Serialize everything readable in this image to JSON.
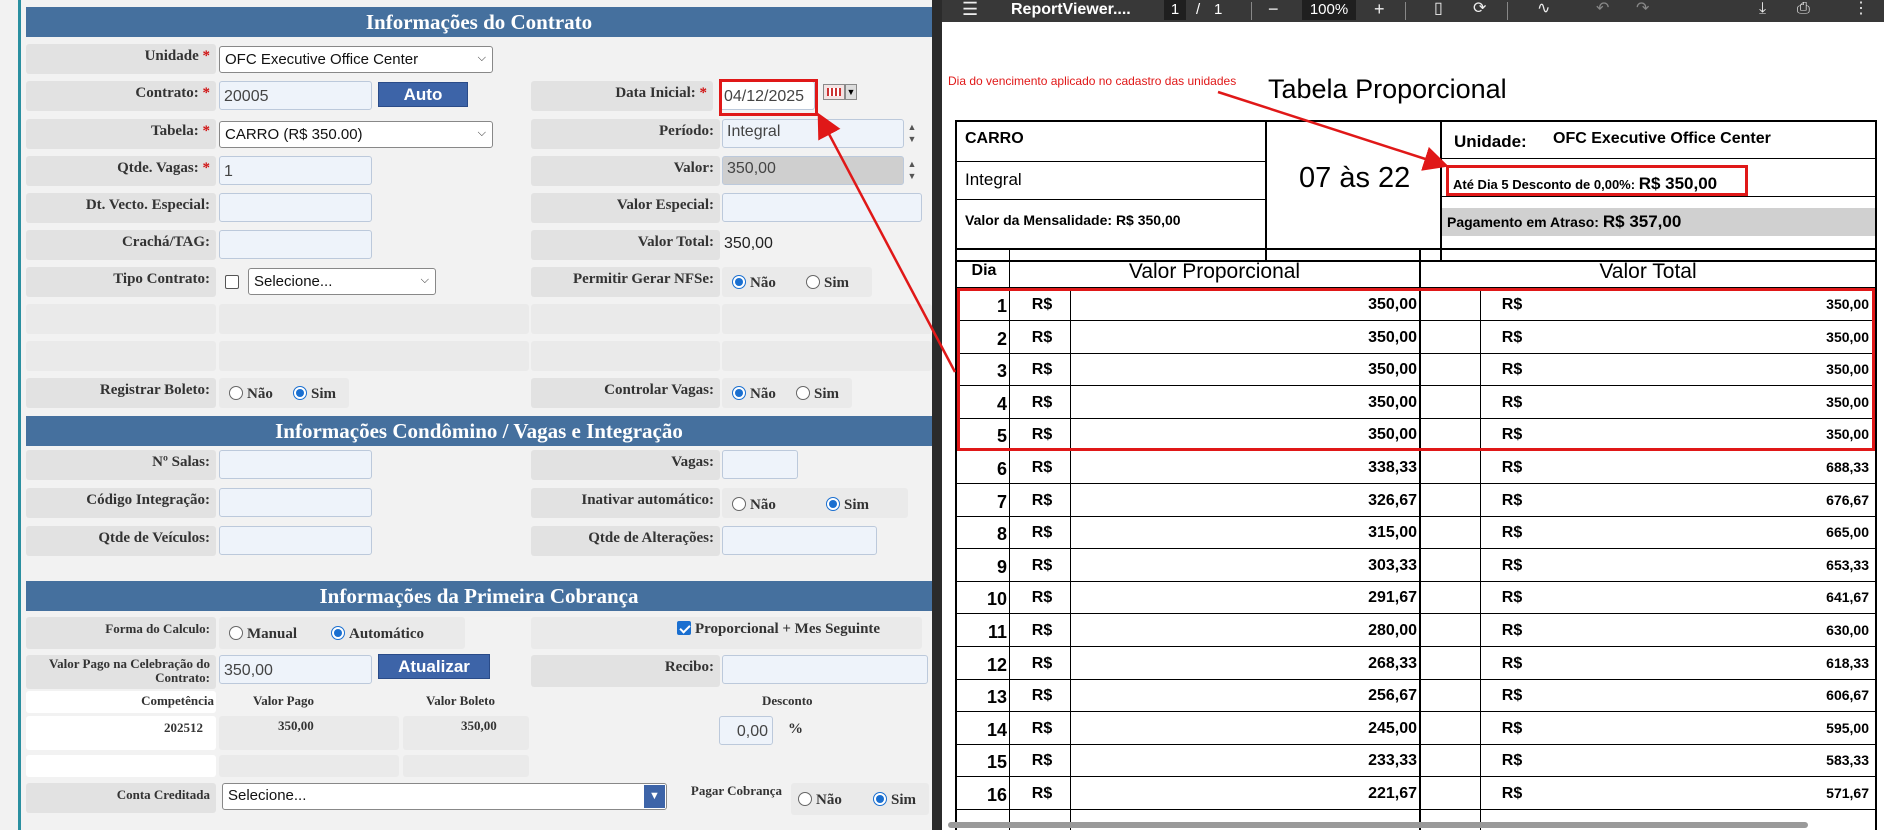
{
  "sections": {
    "contract": "Informações do Contrato",
    "condo": "Informações Condômino / Vagas e Integração",
    "billing": "Informações da Primeira Cobrança"
  },
  "contract": {
    "unidade_label": "Unidade",
    "unidade_value": "OFC Executive Office Center",
    "contrato_label": "Contrato:",
    "contrato_value": "20005",
    "auto_button": "Auto",
    "data_inicial_label": "Data Inicial:",
    "data_inicial_value": "04/12/2025",
    "tabela_label": "Tabela:",
    "tabela_value": "CARRO (R$ 350.00)",
    "periodo_label": "Período:",
    "periodo_value": "Integral",
    "qtde_vagas_label": "Qtde. Vagas:",
    "qtde_vagas_value": "1",
    "valor_label": "Valor:",
    "valor_value": "350,00",
    "dt_vecto_label": "Dt. Vecto. Especial:",
    "valor_especial_label": "Valor Especial:",
    "cracha_label": "Crachá/TAG:",
    "valor_total_label": "Valor Total:",
    "valor_total_value": "350,00",
    "tipo_contrato_label": "Tipo Contrato:",
    "tipo_contrato_value": "Selecione...",
    "permitir_nfse_label": "Permitir Gerar NFSe:",
    "registrar_boleto_label": "Registrar Boleto:",
    "controlar_vagas_label": "Controlar Vagas:",
    "nao": "Não",
    "sim": "Sim"
  },
  "condo": {
    "salas_label": "Nº Salas:",
    "vagas_label": "Vagas:",
    "codigo_label": "Código Integração:",
    "inativar_label": "Inativar automático:",
    "veiculos_label": "Qtde de Veículos:",
    "alteracoes_label": "Qtde de Alterações:"
  },
  "billing": {
    "forma_label": "Forma do Calculo:",
    "manual": "Manual",
    "automatico": "Automático",
    "proporcional_label": "Proporcional + Mes Seguinte",
    "valor_pago_label": "Valor Pago na Celebração do Contrato:",
    "valor_pago_value": "350,00",
    "atualizar_button": "Atualizar",
    "recibo_label": "Recibo:",
    "col_competencia": "Competência",
    "col_valor_pago": "Valor Pago",
    "col_valor_boleto": "Valor Boleto",
    "col_desconto": "Desconto",
    "row_competencia": "202512",
    "row_valor_pago": "350,00",
    "row_valor_boleto": "350,00",
    "desconto_value": "0,00",
    "pct": "%",
    "conta_label": "Conta Creditada",
    "conta_value": "Selecione...",
    "pagar_label": "Pagar Cobrança"
  },
  "viewer": {
    "title": "ReportViewer....",
    "page_current": "1",
    "page_sep": "/",
    "page_total": "1",
    "zoom": "100%"
  },
  "report": {
    "annotation": "Dia do vencimento aplicado no cadastro das unidades",
    "title": "Tabela Proporcional",
    "carro": "CARRO",
    "integral": "Integral",
    "mensalidade": "Valor da Mensalidade: R$ 350,00",
    "horario": "07 às 22",
    "unidade_label": "Unidade:",
    "unidade_value": "OFC Executive Office Center",
    "desconto": "Até Dia 5 Desconto de 0,00%:",
    "desconto_valor": "R$ 350,00",
    "atraso": "Pagamento em Atraso:",
    "atraso_valor": "R$ 357,00",
    "col_dia": "Dia",
    "col_prop": "Valor Proporcional",
    "col_total": "Valor Total",
    "currency": "R$",
    "rows": [
      {
        "dia": "1",
        "prop": "350,00",
        "total": "350,00"
      },
      {
        "dia": "2",
        "prop": "350,00",
        "total": "350,00"
      },
      {
        "dia": "3",
        "prop": "350,00",
        "total": "350,00"
      },
      {
        "dia": "4",
        "prop": "350,00",
        "total": "350,00"
      },
      {
        "dia": "5",
        "prop": "350,00",
        "total": "350,00"
      },
      {
        "dia": "6",
        "prop": "338,33",
        "total": "688,33"
      },
      {
        "dia": "7",
        "prop": "326,67",
        "total": "676,67"
      },
      {
        "dia": "8",
        "prop": "315,00",
        "total": "665,00"
      },
      {
        "dia": "9",
        "prop": "303,33",
        "total": "653,33"
      },
      {
        "dia": "10",
        "prop": "291,67",
        "total": "641,67"
      },
      {
        "dia": "11",
        "prop": "280,00",
        "total": "630,00"
      },
      {
        "dia": "12",
        "prop": "268,33",
        "total": "618,33"
      },
      {
        "dia": "13",
        "prop": "256,67",
        "total": "606,67"
      },
      {
        "dia": "14",
        "prop": "245,00",
        "total": "595,00"
      },
      {
        "dia": "15",
        "prop": "233,33",
        "total": "583,33"
      },
      {
        "dia": "16",
        "prop": "221,67",
        "total": "571,67"
      }
    ]
  }
}
